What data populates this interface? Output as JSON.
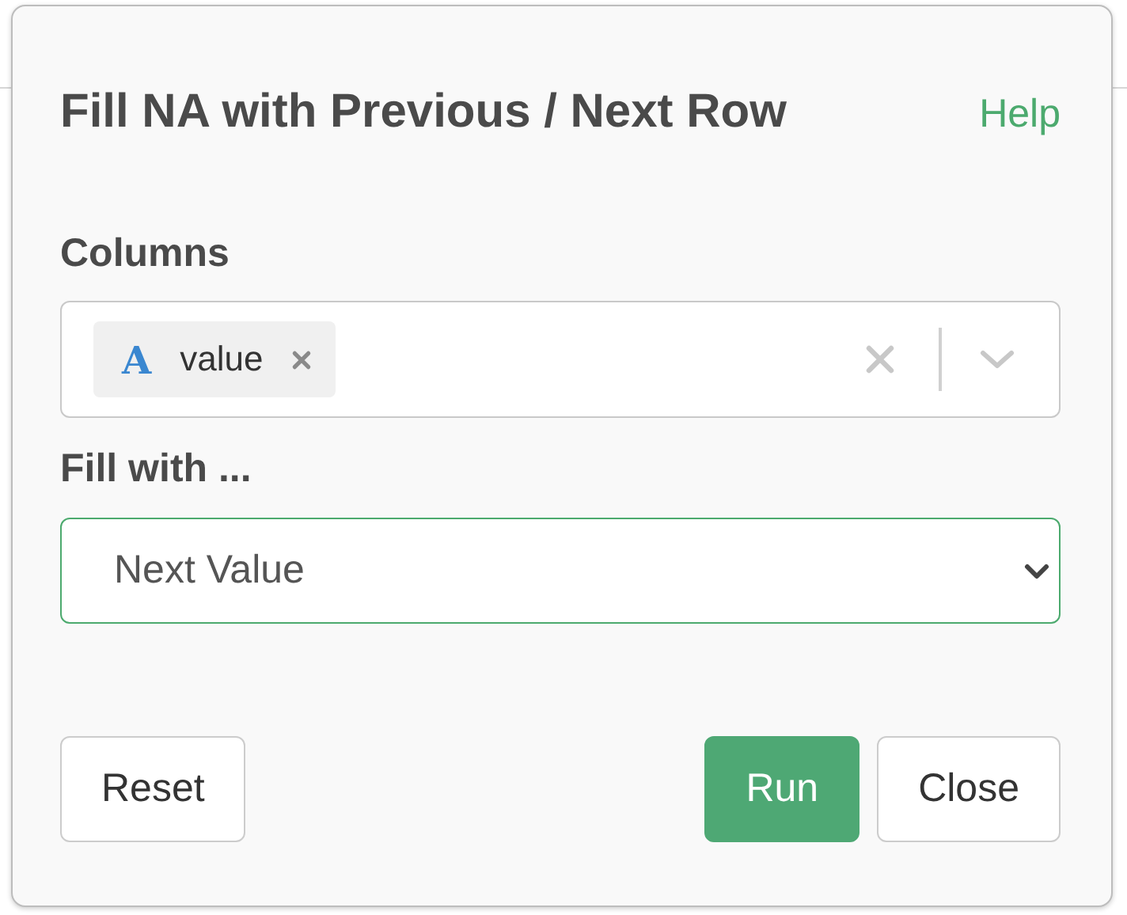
{
  "dialog": {
    "title": "Fill NA with Previous / Next Row",
    "help_link": "Help"
  },
  "columns_field": {
    "label": "Columns",
    "chips": [
      {
        "type_icon": "A",
        "label": "value"
      }
    ]
  },
  "fill_with": {
    "label": "Fill with ...",
    "value": "Next Value"
  },
  "buttons": [
    {
      "label": "Reset",
      "kind": "default"
    },
    {
      "label": "Run",
      "kind": "primary"
    },
    {
      "label": "Close",
      "kind": "default"
    }
  ]
}
